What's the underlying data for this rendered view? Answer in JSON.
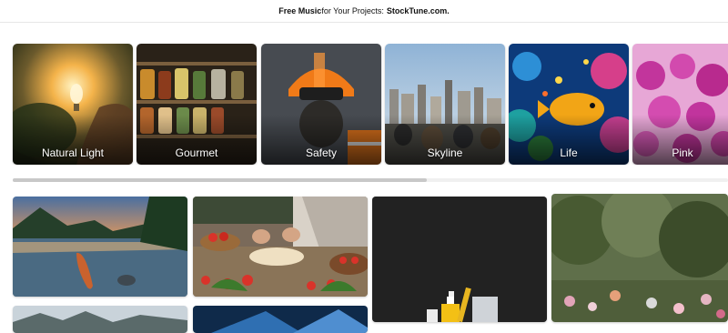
{
  "banner": {
    "lead": "Free Music",
    "middle": " for Your Projects: ",
    "link": "StockTune.com."
  },
  "categories": [
    {
      "label": "Natural Light"
    },
    {
      "label": "Gourmet"
    },
    {
      "label": "Safety"
    },
    {
      "label": "Skyline"
    },
    {
      "label": "Life"
    },
    {
      "label": "Pink"
    }
  ],
  "colors": {
    "text": "#111111",
    "scroll_thumb": "#c8c8c8"
  }
}
